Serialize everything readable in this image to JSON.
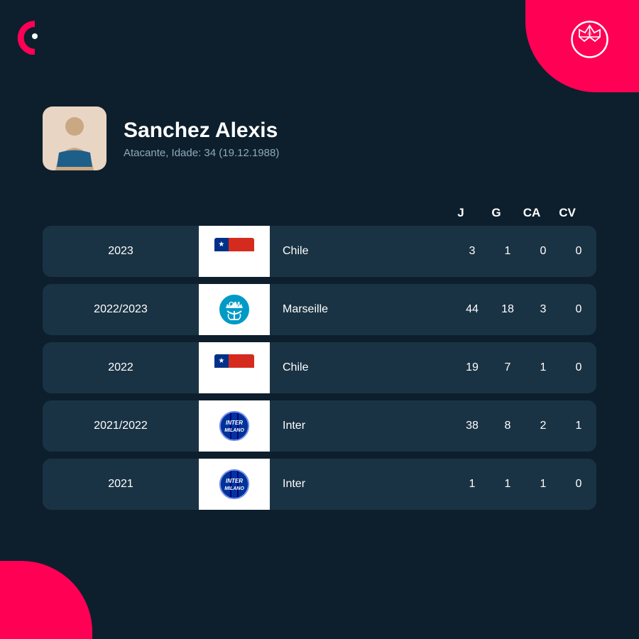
{
  "app": {
    "title": "Sofascore",
    "accent_color": "#ff0055"
  },
  "player": {
    "name": "Sanchez Alexis",
    "details": "Atacante, Idade: 34 (19.12.1988)"
  },
  "table": {
    "headers": {
      "season": "",
      "team": "",
      "j": "J",
      "g": "G",
      "ca": "CA",
      "cv": "CV"
    },
    "rows": [
      {
        "season": "2023",
        "team_name": "Chile",
        "team_type": "chile",
        "j": "3",
        "g": "1",
        "ca": "0",
        "cv": "0"
      },
      {
        "season": "2022/2023",
        "team_name": "Marseille",
        "team_type": "marseille",
        "j": "44",
        "g": "18",
        "ca": "3",
        "cv": "0"
      },
      {
        "season": "2022",
        "team_name": "Chile",
        "team_type": "chile",
        "j": "19",
        "g": "7",
        "ca": "1",
        "cv": "0"
      },
      {
        "season": "2021/2022",
        "team_name": "Inter",
        "team_type": "inter",
        "j": "38",
        "g": "8",
        "ca": "2",
        "cv": "1"
      },
      {
        "season": "2021",
        "team_name": "Inter",
        "team_type": "inter",
        "j": "1",
        "g": "1",
        "ca": "1",
        "cv": "0"
      }
    ]
  }
}
